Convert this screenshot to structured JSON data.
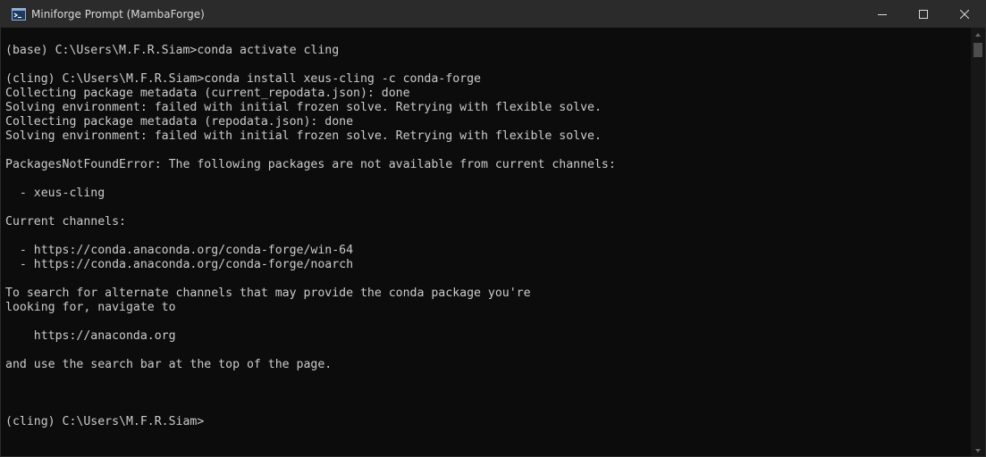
{
  "window": {
    "title": "Miniforge Prompt (MambaForge)"
  },
  "icons": {
    "app": "terminal-prompt-icon",
    "minimize": "minimize-icon",
    "maximize": "maximize-icon",
    "close": "close-icon",
    "scroll_up": "scroll-up-arrow-icon",
    "scroll_down": "scroll-down-arrow-icon"
  },
  "colors": {
    "console_background": "#0c0c0c",
    "console_text": "#cccccc",
    "titlebar": "#2b2b2b"
  },
  "console": {
    "lines": [
      "",
      "(base) C:\\Users\\M.F.R.Siam>conda activate cling",
      "",
      "(cling) C:\\Users\\M.F.R.Siam>conda install xeus-cling -c conda-forge",
      "Collecting package metadata (current_repodata.json): done",
      "Solving environment: failed with initial frozen solve. Retrying with flexible solve.",
      "Collecting package metadata (repodata.json): done",
      "Solving environment: failed with initial frozen solve. Retrying with flexible solve.",
      "",
      "PackagesNotFoundError: The following packages are not available from current channels:",
      "",
      "  - xeus-cling",
      "",
      "Current channels:",
      "",
      "  - https://conda.anaconda.org/conda-forge/win-64",
      "  - https://conda.anaconda.org/conda-forge/noarch",
      "",
      "To search for alternate channels that may provide the conda package you're",
      "looking for, navigate to",
      "",
      "    https://anaconda.org",
      "",
      "and use the search bar at the top of the page.",
      "",
      "",
      "",
      "(cling) C:\\Users\\M.F.R.Siam>"
    ]
  }
}
